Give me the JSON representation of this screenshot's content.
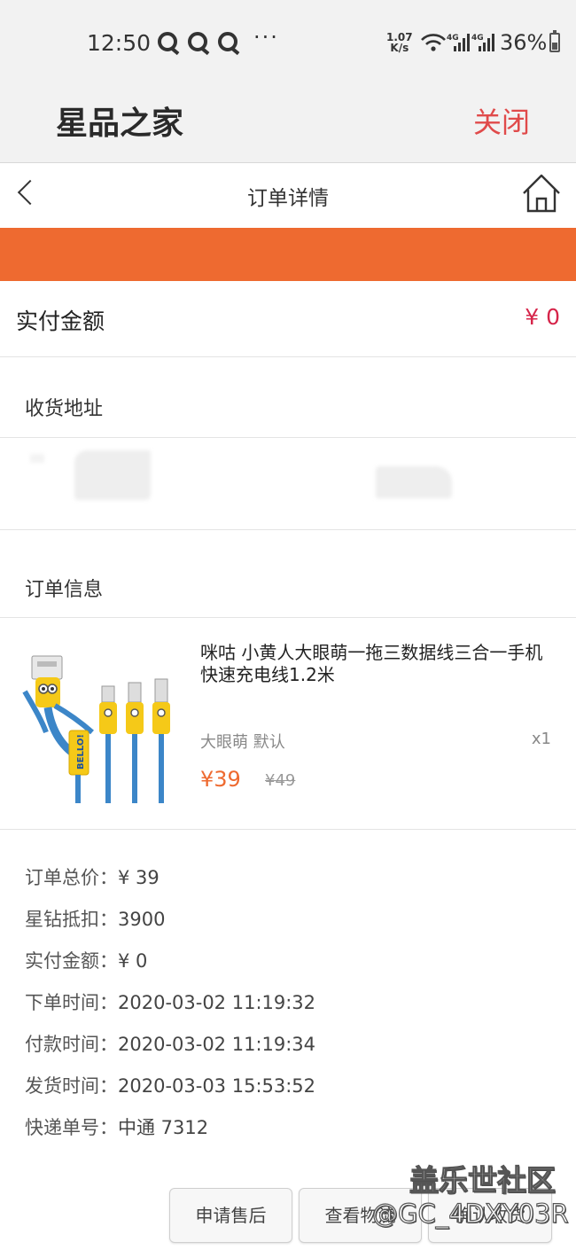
{
  "status_bar": {
    "time": "12:50",
    "more": "···",
    "speed_top": "1.07",
    "speed_bottom": "K/s",
    "net1": "4G",
    "net2": "4G",
    "battery": "36%"
  },
  "app_header": {
    "title": "星品之家",
    "close_label": "关闭",
    "close_color": "#e04a4a"
  },
  "nav": {
    "title": "订单详情"
  },
  "accent_color": "#ee6a30",
  "payment": {
    "label": "实付金额",
    "value": "¥ 0",
    "value_color": "#d6254a"
  },
  "address": {
    "section_title": "收货地址"
  },
  "order_info": {
    "section_title": "订单信息"
  },
  "product": {
    "name": "咪咕 小黄人大眼萌一拖三数据线三合一手机快速充电线1.2米",
    "spec": "大眼萌  默认",
    "quantity": "x1",
    "price": "¥39",
    "original_price": "¥49",
    "image_label": "BELLO!"
  },
  "summary": [
    {
      "label": "订单总价：",
      "value": "¥ 39"
    },
    {
      "label": "星钻抵扣：",
      "value": "3900"
    },
    {
      "label": "实付金额：",
      "value": "¥ 0"
    },
    {
      "label": "下单时间：",
      "value": "2020-03-02 11:19:32"
    },
    {
      "label": "付款时间：",
      "value": "2020-03-02 11:19:34"
    },
    {
      "label": "发货时间：",
      "value": "2020-03-03 15:53:52"
    },
    {
      "label": "快递单号：",
      "value": "中通 7312"
    }
  ],
  "buttons": {
    "after_sale": "申请售后",
    "logistics": "查看物流",
    "third": "确认收货"
  },
  "watermark": {
    "line1": "盖乐世社区",
    "line2": "@GC_4DXY03R"
  }
}
